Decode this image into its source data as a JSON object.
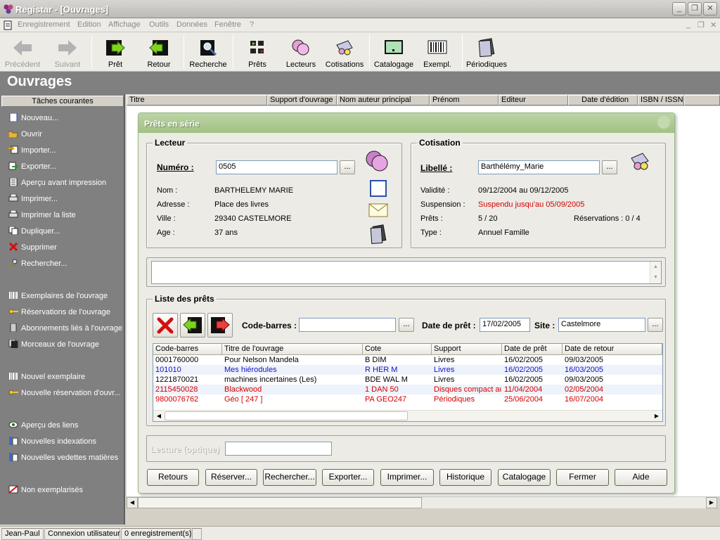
{
  "app": {
    "title": "Registar - [Ouvrages]"
  },
  "menu": [
    "Enregistrement",
    "Edition",
    "Affichage",
    "Outils",
    "Données",
    "Fenêtre",
    "?"
  ],
  "toolbar": [
    {
      "label": "Précédent",
      "icon": "arrow-left-icon",
      "enabled": false
    },
    {
      "label": "Suivant",
      "icon": "arrow-right-icon",
      "enabled": false
    },
    {
      "label": "Prêt",
      "icon": "loan-icon",
      "enabled": true
    },
    {
      "label": "Retour",
      "icon": "return-icon",
      "enabled": true
    },
    {
      "label": "Recherche",
      "icon": "search-icon",
      "enabled": true
    },
    {
      "label": "Prêts",
      "icon": "loans-icon",
      "enabled": true
    },
    {
      "label": "Lecteurs",
      "icon": "readers-icon",
      "enabled": true
    },
    {
      "label": "Cotisations",
      "icon": "subscriptions-icon",
      "enabled": true
    },
    {
      "label": "Catalogage",
      "icon": "catalog-icon",
      "enabled": true
    },
    {
      "label": "Exempl.",
      "icon": "barcode-icon",
      "enabled": true
    },
    {
      "label": "Périodiques",
      "icon": "periodicals-icon",
      "enabled": true
    }
  ],
  "section_title": "Ouvrages",
  "sidebar": {
    "header": "Tâches courantes",
    "items": [
      "Nouveau...",
      "Ouvrir",
      "Importer...",
      "Exporter...",
      "Aperçu avant impression",
      "Imprimer...",
      "Imprimer la liste",
      "Dupliquer...",
      "Supprimer",
      "Rechercher...",
      "Exemplaires de l'ouvrage",
      "Réservations de l'ouvrage",
      "Abonnements liés à l'ouvrage",
      "Morceaux de l'ouvrage",
      "Nouvel exemplaire",
      "Nouvelle réservation d'ouvr...",
      "Aperçu des liens",
      "Nouvelles indexations",
      "Nouvelles vedettes matières",
      "Non exemplarisés"
    ]
  },
  "columns": [
    "Titre",
    "Support d'ouvrage",
    "Nom auteur principal",
    "Prénom",
    "Editeur",
    "Date d'édition",
    "ISBN / ISSN"
  ],
  "dialog": {
    "title": "Prêts en série",
    "lecteur": {
      "group": "Lecteur",
      "numero_label": "Numéro :",
      "numero_value": "0505",
      "fields": [
        {
          "label": "Nom :",
          "value": "BARTHELEMY MARIE"
        },
        {
          "label": "Adresse :",
          "value": "Place des livres"
        },
        {
          "label": "Ville :",
          "value": "29340 CASTELMORE"
        },
        {
          "label": "Age :",
          "value": "37 ans"
        }
      ]
    },
    "cotisation": {
      "group": "Cotisation",
      "libelle_label": "Libellé :",
      "libelle_value": "Barthélémy_Marie",
      "validite_label": "Validité :",
      "validite_value": "09/12/2004 au 09/12/2005",
      "suspension_label": "Suspension :",
      "suspension_value": "Suspendu jusqu'au 05/09/2005",
      "prets_label": "Prêts :",
      "prets_value": "5 / 20",
      "reservations": "Réservations : 0 / 4",
      "type_label": "Type :",
      "type_value": "Annuel Famille"
    },
    "liste": {
      "group": "Liste des prêts",
      "codebarres_label": "Code-barres :",
      "codebarres_value": "",
      "datepret_label": "Date de prêt :",
      "datepret_value": "17/02/2005",
      "site_label": "Site :",
      "site_value": "Castelmore",
      "headers": [
        "Code-barres",
        "Titre de l'ouvrage",
        "Cote",
        "Support",
        "Date de prêt",
        "Date de retour"
      ],
      "rows": [
        {
          "cells": [
            "0001760000",
            "Pour Nelson Mandela",
            "B DIM",
            "Livres",
            "16/02/2005",
            "09/03/2005"
          ],
          "color": "black"
        },
        {
          "cells": [
            "101010",
            "Mes hiérodules",
            "R HER M",
            "Livres",
            "16/02/2005",
            "16/03/2005"
          ],
          "color": "blue"
        },
        {
          "cells": [
            "1221870021",
            "machines incertaines (Les)",
            "BDE WAL M",
            "Livres",
            "16/02/2005",
            "09/03/2005"
          ],
          "color": "black"
        },
        {
          "cells": [
            "2115450028",
            "Blackwood",
            "1 DAN 50",
            "Disques compact au",
            "11/04/2004",
            "02/05/2004"
          ],
          "color": "red"
        },
        {
          "cells": [
            "9800076762",
            "Géo [ 247 ]",
            "PA GEO247",
            "Périodiques",
            "25/06/2004",
            "16/07/2004"
          ],
          "color": "red"
        }
      ]
    },
    "lecture_label": "Lecture (optique)",
    "buttons": [
      "Retours",
      "Réserver...",
      "Rechercher...",
      "Exporter...",
      "Imprimer...",
      "Historique",
      "Catalogage",
      "Fermer",
      "Aide"
    ]
  },
  "status": [
    "Jean-Paul",
    "Connexion utilisateur",
    "0 enregistrement(s)"
  ]
}
